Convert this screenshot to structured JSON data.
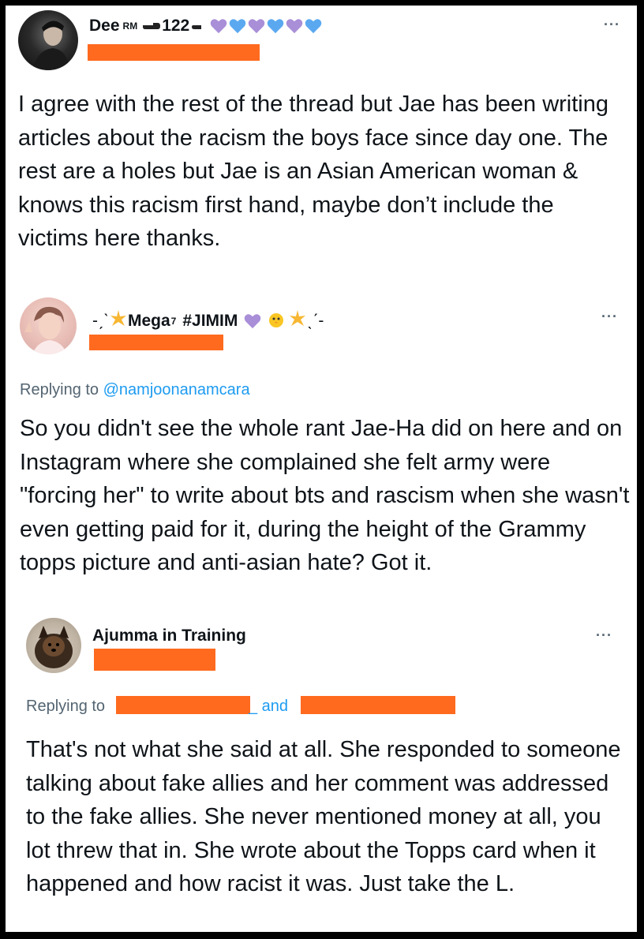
{
  "tweets": [
    {
      "display_name": "Dee",
      "superscript": "RM",
      "extra": "122",
      "text": "I agree with the rest of the thread but Jae has been writing articles about the racism the boys face since day one. The rest are a holes but Jae is an Asian American woman & knows this racism first hand, maybe don’t include the victims here thanks.",
      "more": "···"
    },
    {
      "display_name_prefix": "-ˏˋ",
      "display_name": "Mega",
      "superscript": "7",
      "hashtag": "#JIMIM",
      "display_name_suffix": "ˎˊ-",
      "reply_prefix": "Replying to",
      "reply_handle": "@namjoonanamcara",
      "text": "So you didn't see the whole rant Jae-Ha did on here and on Instagram where she complained she felt army were \"forcing her\" to write about bts and rascism when she wasn't even getting paid for it, during the height of the Grammy topps picture and anti-asian hate? Got it.",
      "more": "···"
    },
    {
      "display_name": "Ajumma in Training",
      "reply_prefix": "Replying to",
      "reply_and": "_ and",
      "text": "That's not what she said at all. She responded to someone talking about fake allies and her comment was addressed to the fake allies. She never mentioned money at all, you lot threw that in. She wrote about the Topps card when it happened and how racist it was. Just take the L.",
      "more": "···"
    }
  ],
  "colors": {
    "redaction": "#ff6a1f",
    "purple_heart": "#a98ed8",
    "blue_heart": "#5aa9f0",
    "link": "#1d9bf0",
    "muted": "#536471"
  }
}
